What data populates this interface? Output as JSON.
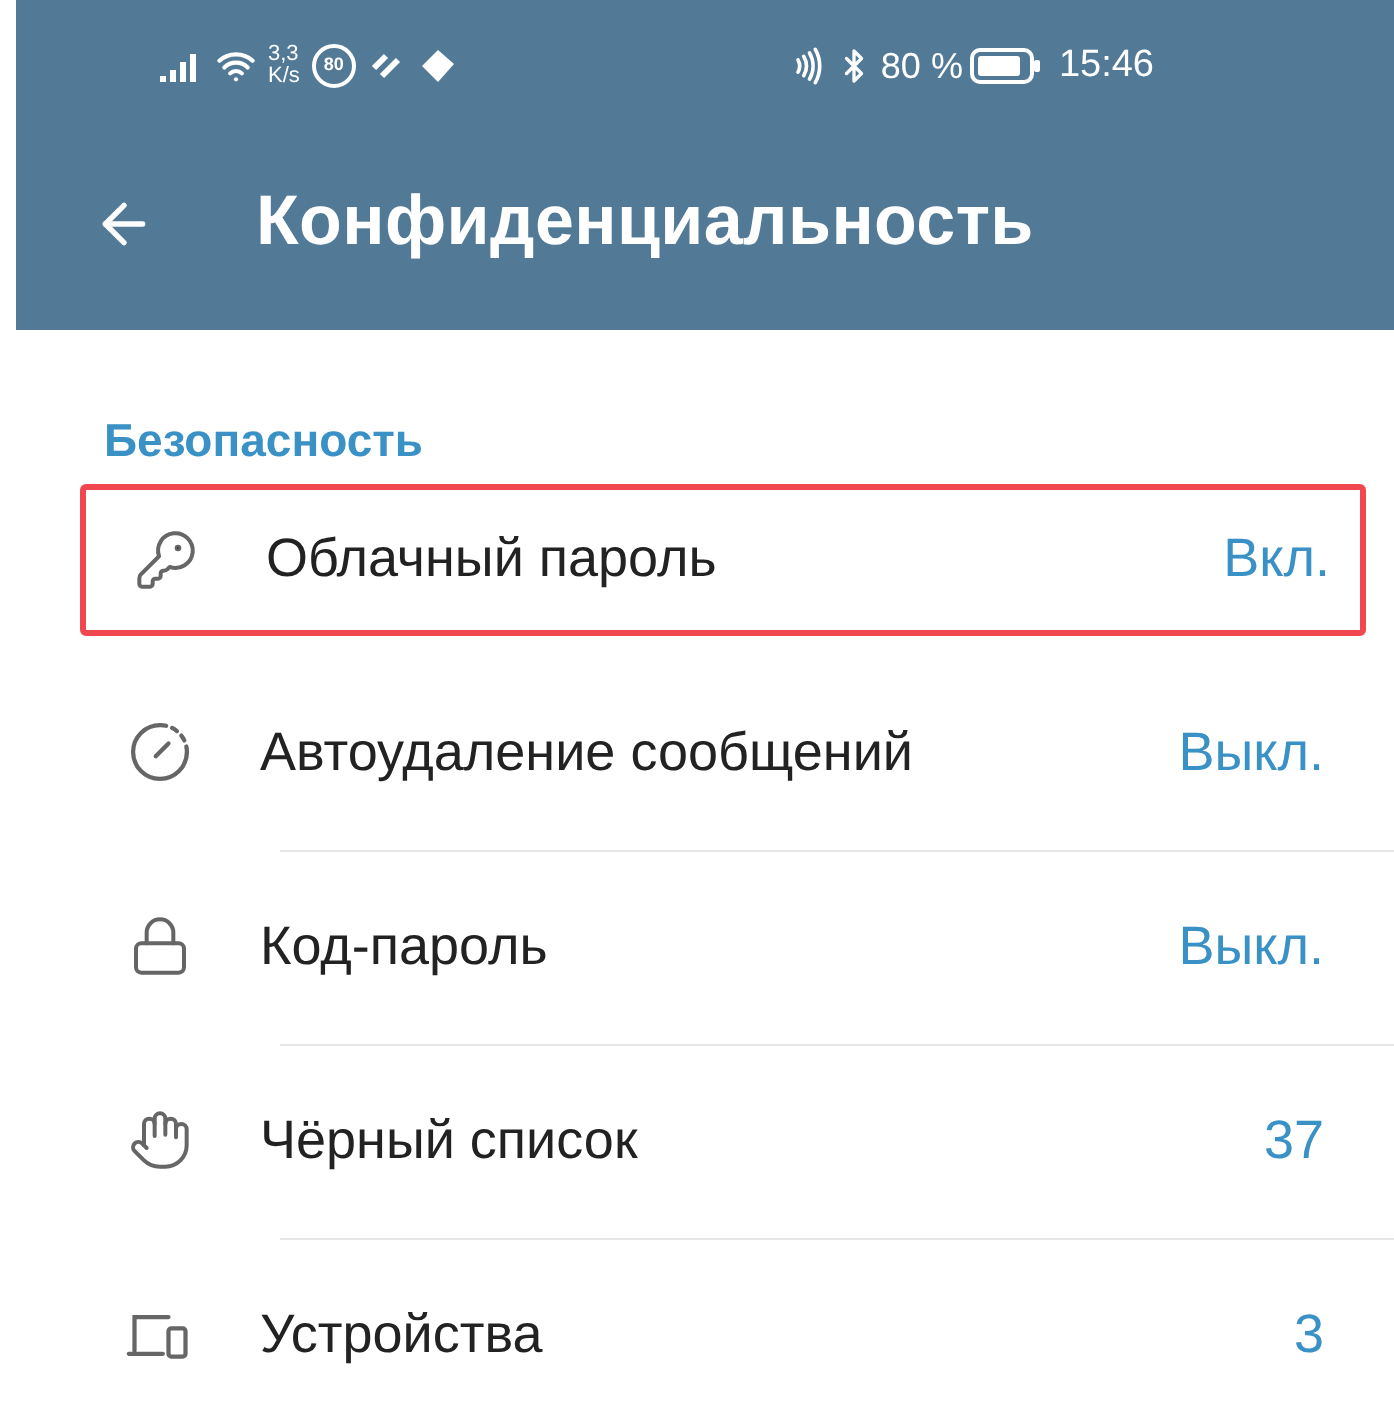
{
  "status_bar": {
    "speed_value": "3,3",
    "speed_unit": "K/s",
    "badge": "80",
    "battery": "80 %",
    "time": "15:46"
  },
  "app_bar": {
    "title": "Конфиденциальность"
  },
  "section": {
    "title": "Безопасность"
  },
  "items": [
    {
      "kind": "key",
      "label": "Облачный пароль",
      "value": "Вкл.",
      "highlighted": true
    },
    {
      "kind": "timer",
      "label": "Автоудаление сообщений",
      "value": "Выкл.",
      "highlighted": false
    },
    {
      "kind": "lock",
      "label": "Код-пароль",
      "value": "Выкл.",
      "highlighted": false
    },
    {
      "kind": "hand",
      "label": "Чёрный список",
      "value": "37",
      "highlighted": false
    },
    {
      "kind": "devices",
      "label": "Устройства",
      "value": "3",
      "highlighted": false
    }
  ]
}
